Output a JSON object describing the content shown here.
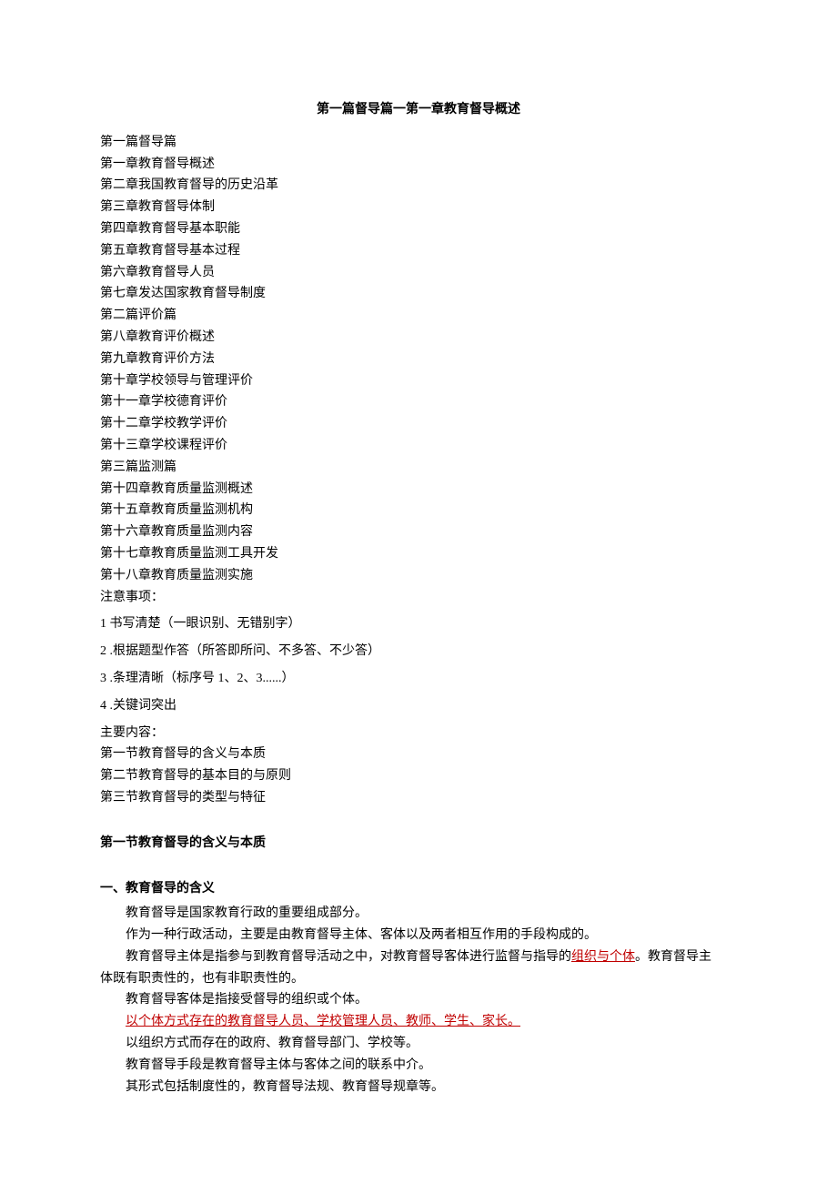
{
  "title": "第一篇督导篇一第一章教育督导概述",
  "toc": [
    "第一篇督导篇",
    "第一章教育督导概述",
    "第二章我国教育督导的历史沿革",
    "第三章教育督导体制",
    "第四章教育督导基本职能",
    "第五章教育督导基本过程",
    "第六章教育督导人员",
    "第七章发达国家教育督导制度",
    "第二篇评价篇",
    "第八章教育评价概述",
    "第九章教育评价方法",
    "第十章学校领导与管理评价",
    "第十一章学校德育评价",
    "第十二章学校教学评价",
    "第十三章学校课程评价",
    "第三篇监测篇",
    "第十四章教育质量监测概述",
    "第十五章教育质量监测机构",
    "第十六章教育质量监测内容",
    "第十七章教育质量监测工具开发",
    "第十八章教育质量监测实施"
  ],
  "notes_label": "注意事项：",
  "notes": [
    "1 书写清楚（一眼识别、无错别字）",
    "2 .根据题型作答（所答即所问、不多答、不少答）",
    "3 .条理清晰（标序号 1、2、3......）",
    "4 .关键词突出"
  ],
  "main_contents_label": "主要内容：",
  "main_contents": [
    "第一节教育督导的含义与本质",
    "第二节教育督导的基本目的与原则",
    "第三节教育督导的类型与特征"
  ],
  "section1_heading": "第一节教育督导的含义与本质",
  "section1_sub_heading": "一、教育督导的含义",
  "section1_p1": "教育督导是国家教育行政的重要组成部分。",
  "section1_p2": "作为一种行政活动，主要是由教育督导主体、客体以及两者相互作用的手段构成的。",
  "section1_p3_prefix": "教育督导主体是指参与到教育督导活动之中，对教育督导客体进行监督与指导的",
  "section1_p3_highlight": "组织与个体",
  "section1_p3_suffix_a": "。教育督导主",
  "section1_p3_line2": "体既有职责性的，也有非职责性的。",
  "section1_p4": "教育督导客体是指接受督导的组织或个体。",
  "section1_p5_highlight": "以个体方式存在的教育督导人员、学校管理人员、教师、学生、家长。",
  "section1_p6": "以组织方式而存在的政府、教育督导部门、学校等。",
  "section1_p7": "教育督导手段是教育督导主体与客体之间的联系中介。",
  "section1_p8": "其形式包括制度性的，教育督导法规、教育督导规章等。"
}
